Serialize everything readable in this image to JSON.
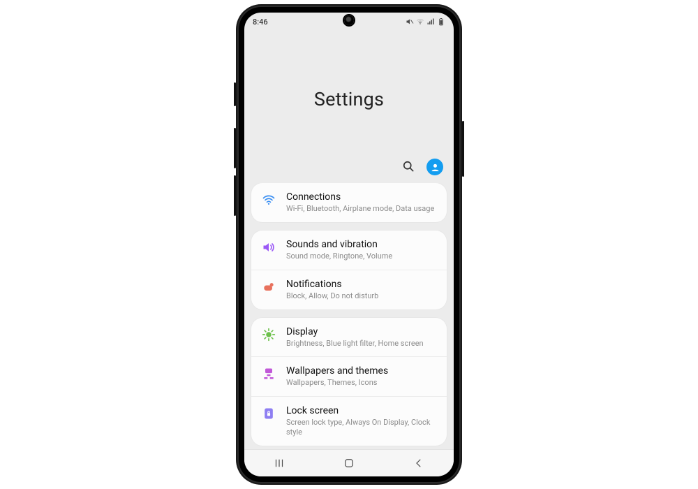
{
  "status": {
    "time": "8:46"
  },
  "header": {
    "title": "Settings"
  },
  "groups": [
    {
      "rows": [
        {
          "icon": "wifi",
          "color": "#3b8ff2",
          "title": "Connections",
          "sub": "Wi-Fi, Bluetooth, Airplane mode, Data usage"
        }
      ]
    },
    {
      "rows": [
        {
          "icon": "volume",
          "color": "#9b59f6",
          "title": "Sounds and vibration",
          "sub": "Sound mode, Ringtone, Volume"
        },
        {
          "icon": "notification",
          "color": "#e8715d",
          "title": "Notifications",
          "sub": "Block, Allow, Do not disturb"
        }
      ]
    },
    {
      "rows": [
        {
          "icon": "display",
          "color": "#6cc04a",
          "title": "Display",
          "sub": "Brightness, Blue light filter, Home screen"
        },
        {
          "icon": "wallpaper",
          "color": "#c158d8",
          "title": "Wallpapers and themes",
          "sub": "Wallpapers, Themes, Icons"
        },
        {
          "icon": "lock",
          "color": "#8e7ef2",
          "title": "Lock screen",
          "sub": "Screen lock type, Always On Display, Clock style"
        }
      ]
    }
  ]
}
